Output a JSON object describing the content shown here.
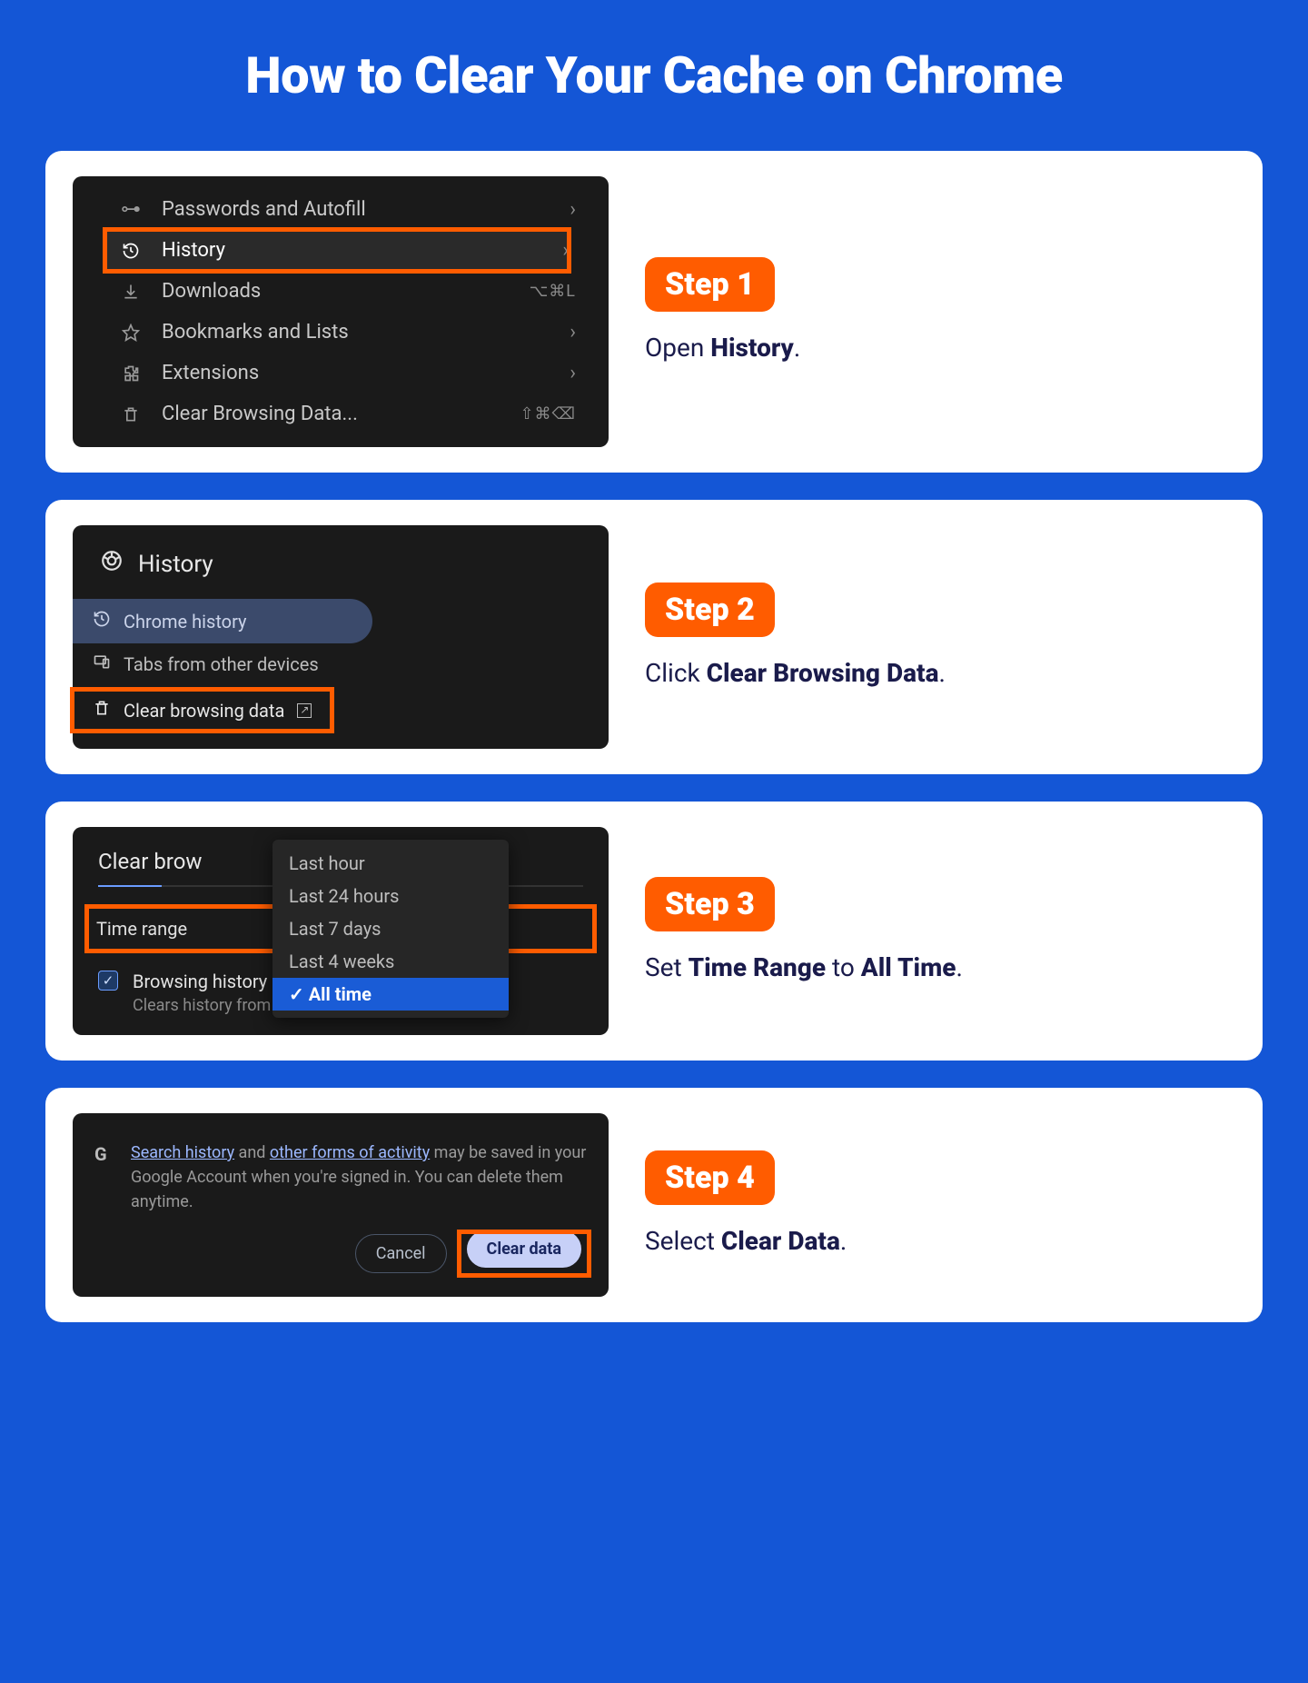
{
  "title": "How to Clear Your Cache on Chrome",
  "steps": {
    "s1": {
      "badge": "Step 1",
      "text_pre": "Open ",
      "text_bold": "History",
      "text_post": ".",
      "menu": {
        "passwords": "Passwords and Autofill",
        "history": "History",
        "downloads": "Downloads",
        "downloads_sc": "⌥⌘L",
        "bookmarks": "Bookmarks and Lists",
        "extensions": "Extensions",
        "clear": "Clear Browsing Data...",
        "clear_sc": "⇧⌘⌫"
      }
    },
    "s2": {
      "badge": "Step 2",
      "text_pre": "Click ",
      "text_bold": "Clear Browsing Data",
      "text_post": ".",
      "header": "History",
      "chrome_history": "Chrome history",
      "tabs": "Tabs from other devices",
      "clear": "Clear browsing data"
    },
    "s3": {
      "badge": "Step 3",
      "text_pre": "Set ",
      "text_bold1": "Time Range",
      "text_mid": " to ",
      "text_bold2": "All Time",
      "text_post": ".",
      "title": "Clear brow",
      "range_label": "Time range",
      "options": [
        "Last hour",
        "Last 24 hours",
        "Last 7 days",
        "Last 4 weeks",
        "All time"
      ],
      "chk_title": "Browsing history",
      "chk_desc": "Clears history from all synced devices"
    },
    "s4": {
      "badge": "Step 4",
      "text_pre": "Select ",
      "text_bold": "Clear Data",
      "text_post": ".",
      "info_link1": "Search history",
      "info_mid1": " and ",
      "info_link2": "other forms of activity",
      "info_rest": " may be saved in your Google Account when you're signed in. You can delete them anytime.",
      "cancel": "Cancel",
      "clear": "Clear data"
    }
  }
}
